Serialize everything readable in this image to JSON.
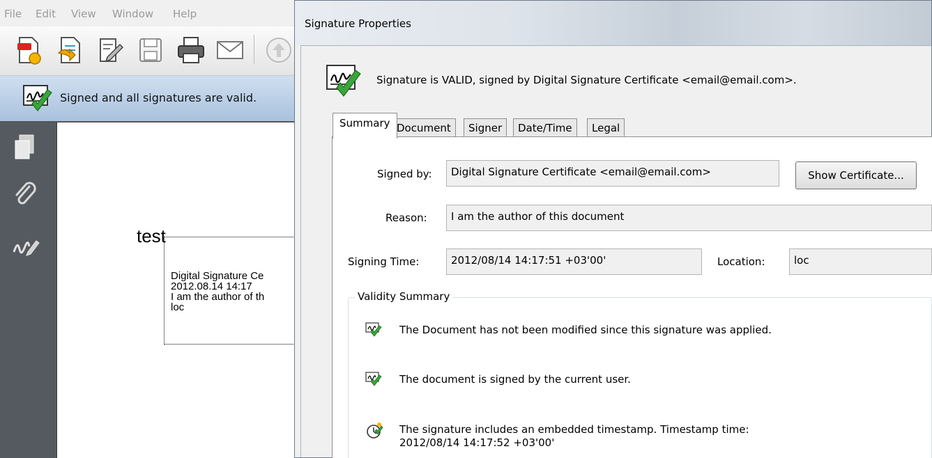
{
  "menu": [
    "File",
    "Edit",
    "View",
    "Window",
    "Help"
  ],
  "toolbar_icons": [
    "create-pdf-icon",
    "open-icon",
    "edit-icon",
    "save-icon",
    "print-icon",
    "email-icon",
    "up-arrow-icon"
  ],
  "status": {
    "text": "Signed and all signatures are valid."
  },
  "nav_icons": [
    "pages-icon",
    "attachments-icon",
    "signatures-icon"
  ],
  "document": {
    "title": "test",
    "signature_lines": [
      "Digital Signature Ce",
      "2012.08.14 14:17",
      "I am the author of th",
      "loc"
    ]
  },
  "dialog": {
    "title": "Signature Properties",
    "header_text": "Signature is VALID, signed by Digital Signature Certificate <email@email.com>.",
    "tabs": [
      "Summary",
      "Document",
      "Signer",
      "Date/Time",
      "Legal"
    ],
    "active_tab": "Summary",
    "fields": {
      "signed_by_label": "Signed by:",
      "signed_by_value": "Digital Signature Certificate <email@email.com>",
      "show_certificate": "Show Certificate...",
      "reason_label": "Reason:",
      "reason_value": "I am the author of this document",
      "signing_time_label": "Signing Time:",
      "signing_time_value": "2012/08/14 14:17:51 +03'00'",
      "location_label": "Location:",
      "location_value": "loc"
    },
    "validity": {
      "legend": "Validity Summary",
      "items": [
        {
          "icon": "signature-check-icon",
          "text": "The Document has not been modified since this signature was applied."
        },
        {
          "icon": "signature-check-icon",
          "text": "The document is signed by the current user."
        },
        {
          "icon": "timestamp-clock-icon",
          "line1": "The signature includes an embedded timestamp. Timestamp time:",
          "line2": "2012/08/14 14:17:52 +03'00'"
        }
      ]
    }
  },
  "colors": {
    "valid_green": "#2e9a2e",
    "status_bar_blue": "#b9cde3"
  }
}
